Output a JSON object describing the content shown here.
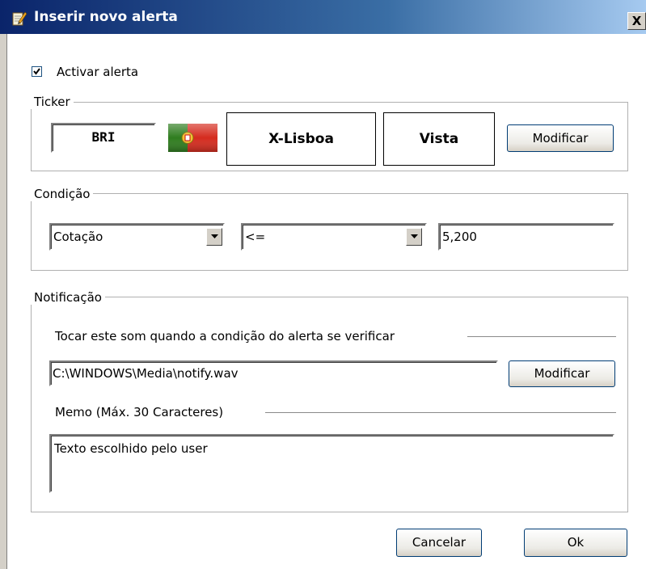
{
  "window": {
    "title": "Inserir novo alerta",
    "close_glyph": "X"
  },
  "activate": {
    "label": "Activar alerta",
    "checked": true
  },
  "ticker": {
    "group_label": "Ticker",
    "symbol": "BRI",
    "flag_icon": "portugal-flag-icon",
    "market": "X-Lisboa",
    "view": "Vista",
    "modify_label": "Modificar"
  },
  "condition": {
    "group_label": "Condição",
    "field_select": "Cotação",
    "operator_select": "<=",
    "value": "5,200"
  },
  "notification": {
    "group_label": "Notificação",
    "sound_caption": "Tocar este som quando a condição do alerta se verificar",
    "sound_path": "C:\\WINDOWS\\Media\\notify.wav",
    "modify_label": "Modificar",
    "memo_caption": "Memo (Máx. 30 Caracteres)",
    "memo_text": "Texto escolhido pelo user"
  },
  "footer": {
    "cancel_label": "Cancelar",
    "ok_label": "Ok"
  },
  "colors": {
    "titlebar_start": "#0a246a",
    "titlebar_end": "#a6caf0",
    "button_border": "#003c74"
  }
}
